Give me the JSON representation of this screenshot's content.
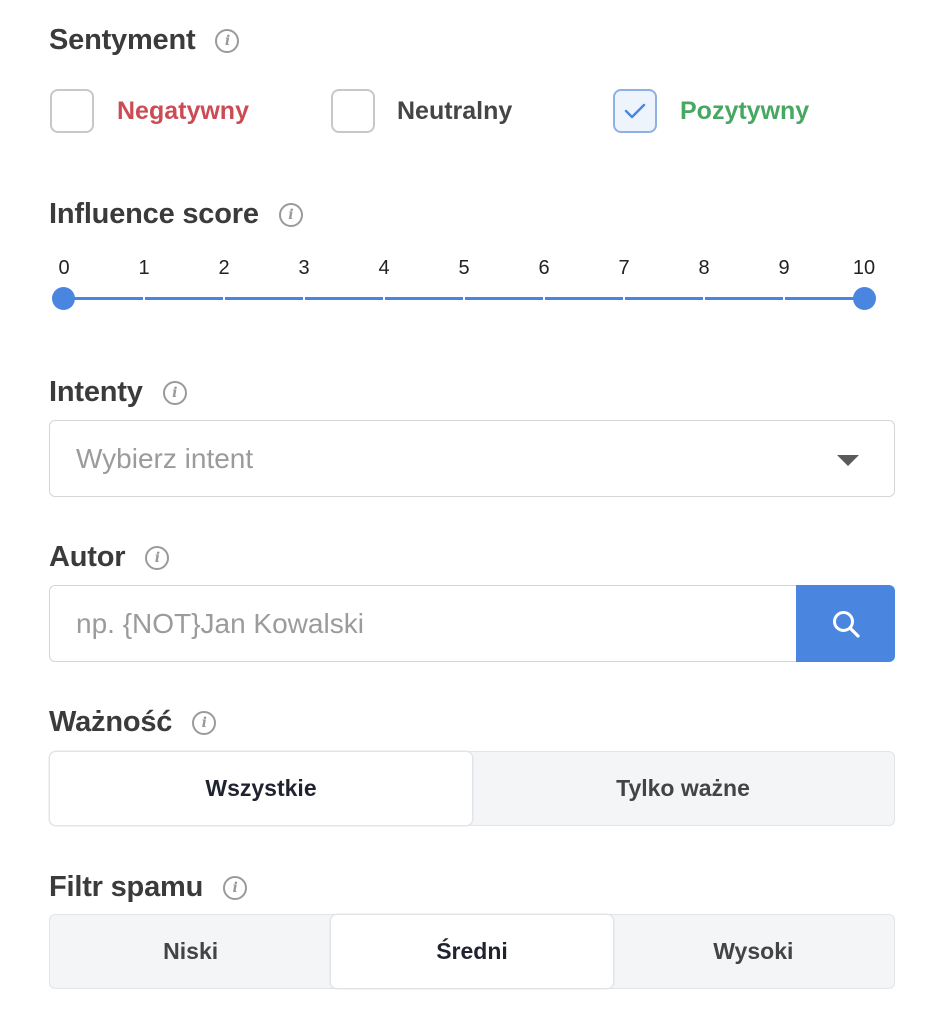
{
  "sentiment": {
    "title": "Sentyment",
    "options": [
      {
        "label": "Negatywny",
        "checked": false,
        "color": "#cc4c56"
      },
      {
        "label": "Neutralny",
        "checked": false,
        "color": "#454545"
      },
      {
        "label": "Pozytywny",
        "checked": true,
        "color": "#47a862"
      }
    ]
  },
  "influence": {
    "title": "Influence score",
    "ticks": [
      "0",
      "1",
      "2",
      "3",
      "4",
      "5",
      "6",
      "7",
      "8",
      "9",
      "10"
    ],
    "min_value": 0,
    "max_value": 10,
    "accent": "#4a86e0"
  },
  "intents": {
    "title": "Intenty",
    "placeholder": "Wybierz intent"
  },
  "author": {
    "title": "Autor",
    "placeholder": "np. {NOT}Jan Kowalski",
    "button_icon": "search-icon"
  },
  "importance": {
    "title": "Ważność",
    "options": [
      "Wszystkie",
      "Tylko ważne"
    ],
    "selected": "Wszystkie"
  },
  "spam": {
    "title": "Filtr spamu",
    "options": [
      "Niski",
      "Średni",
      "Wysoki"
    ],
    "selected": "Średni"
  },
  "info_icon_glyph": "i"
}
